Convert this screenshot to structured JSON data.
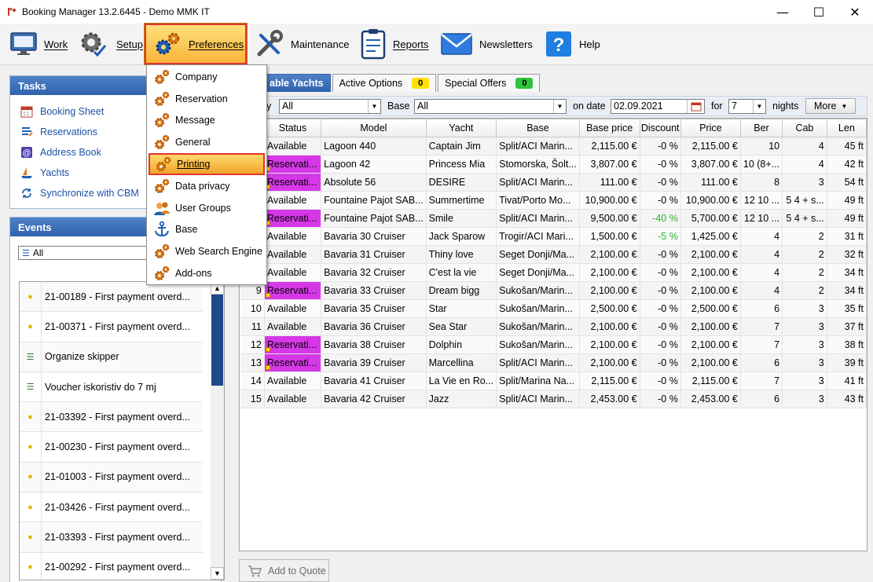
{
  "window": {
    "title": "Booking Manager 13.2.6445 - Demo MMK IT",
    "controls": [
      "minimize",
      "maximize",
      "close"
    ]
  },
  "toolbar": {
    "work": "Work",
    "setup": "Setup",
    "preferences": "Preferences",
    "maintenance": "Maintenance",
    "reports": "Reports",
    "newsletters": "Newsletters",
    "help": "Help"
  },
  "preferences_menu": {
    "items": [
      "Company",
      "Reservation",
      "Message",
      "General",
      "Printing",
      "Data privacy",
      "User Groups",
      "Base",
      "Web Search Engine",
      "Add-ons"
    ],
    "highlighted": "Printing"
  },
  "tasks": {
    "title": "Tasks",
    "items": [
      "Booking Sheet",
      "Reservations",
      "Address Book",
      "Yachts",
      "Synchronize with CBM"
    ]
  },
  "events": {
    "title": "Events",
    "filter": "All",
    "items": [
      "21-00189 - First payment overd...",
      "21-00371 - First payment overd...",
      "Organize skipper",
      "Voucher iskoristiv do 7 mj",
      "21-03392 - First payment overd...",
      "21-00230 - First payment overd...",
      "21-01003 - First payment overd...",
      "21-03426 - First payment overd...",
      "21-03393 - First payment overd...",
      "21-00292 - First payment overd..."
    ]
  },
  "tabs": [
    {
      "label": "able Yachts",
      "badge": null
    },
    {
      "label": "Active Options",
      "badge": "0"
    },
    {
      "label": "Special Offers",
      "badge": "0"
    }
  ],
  "filters": {
    "category_label": "y",
    "category_value": "All",
    "base_label": "Base",
    "base_value": "All",
    "date_label": "on date",
    "date_value": "02.09.2021",
    "for_label": "for",
    "nights_value": "7",
    "nights_label": "nights",
    "more_button": "More"
  },
  "grid": {
    "columns": [
      "",
      "Status",
      "Model",
      "Yacht",
      "Base",
      "Base price",
      "Discount",
      "Price",
      "Ber",
      "Cab",
      "Len"
    ],
    "rows": [
      [
        "",
        "Available",
        "Lagoon 440",
        "Captain Jim",
        "Split/ACI Marin...",
        "2,115.00 €",
        "-0 %",
        "2,115.00 €",
        "10",
        "4",
        "45 ft"
      ],
      [
        "",
        "Reservati...",
        "Lagoon 42",
        "Princess Mia",
        "Stomorska, Šolt...",
        "3,807.00 €",
        "-0 %",
        "3,807.00 €",
        "10 (8+...",
        "4",
        "42 ft"
      ],
      [
        "",
        "Reservati...",
        "Absolute 56",
        "DESIRE",
        "Split/ACI Marin...",
        "111.00 €",
        "-0 %",
        "111.00 €",
        "8",
        "3",
        "54 ft"
      ],
      [
        "",
        "Available",
        "Fountaine Pajot SAB...",
        "Summertime",
        "Tivat/Porto Mo...",
        "10,900.00 €",
        "-0 %",
        "10,900.00 €",
        "12 10 ...",
        "5 4 + s...",
        "49 ft"
      ],
      [
        "",
        "Reservati...",
        "Fountaine Pajot SAB...",
        "Smile",
        "Split/ACI Marin...",
        "9,500.00 €",
        "-40 %",
        "5,700.00 €",
        "12 10 ...",
        "5 4 + s...",
        "49 ft"
      ],
      [
        "",
        "Available",
        "Bavaria 30 Cruiser",
        "Jack Sparow",
        "Trogir/ACI Mari...",
        "1,500.00 €",
        "-5 %",
        "1,425.00 €",
        "4",
        "2",
        "31 ft"
      ],
      [
        "",
        "Available",
        "Bavaria 31 Cruiser",
        "Thiny love",
        "Seget Donji/Ma...",
        "2,100.00 €",
        "-0 %",
        "2,100.00 €",
        "4",
        "2",
        "32 ft"
      ],
      [
        "",
        "Available",
        "Bavaria 32 Cruiser",
        "C'est la vie",
        "Seget Donji/Ma...",
        "2,100.00 €",
        "-0 %",
        "2,100.00 €",
        "4",
        "2",
        "34 ft"
      ],
      [
        "9",
        "Reservati...",
        "Bavaria 33 Cruiser",
        "Dream bigg",
        "Sukošan/Marin...",
        "2,100.00 €",
        "-0 %",
        "2,100.00 €",
        "4",
        "2",
        "34 ft"
      ],
      [
        "10",
        "Available",
        "Bavaria 35 Cruiser",
        "Star",
        "Sukošan/Marin...",
        "2,500.00 €",
        "-0 %",
        "2,500.00 €",
        "6",
        "3",
        "35 ft"
      ],
      [
        "11",
        "Available",
        "Bavaria 36 Cruiser",
        "Sea Star",
        "Sukošan/Marin...",
        "2,100.00 €",
        "-0 %",
        "2,100.00 €",
        "7",
        "3",
        "37 ft"
      ],
      [
        "12",
        "Reservati...",
        "Bavaria 38 Cruiser",
        "Dolphin",
        "Sukošan/Marin...",
        "2,100.00 €",
        "-0 %",
        "2,100.00 €",
        "7",
        "3",
        "38 ft"
      ],
      [
        "13",
        "Reservati...",
        "Bavaria 39 Cruiser",
        "Marcellina",
        "Split/ACI Marin...",
        "2,100.00 €",
        "-0 %",
        "2,100.00 €",
        "6",
        "3",
        "39 ft"
      ],
      [
        "14",
        "Available",
        "Bavaria 41 Cruiser",
        "La Vie en Ro...",
        "Split/Marina Na...",
        "2,115.00 €",
        "-0 %",
        "2,115.00 €",
        "7",
        "3",
        "41 ft"
      ],
      [
        "15",
        "Available",
        "Bavaria 42 Cruiser",
        "Jazz",
        "Split/ACI Marin...",
        "2,453.00 €",
        "-0 %",
        "2,453.00 €",
        "6",
        "3",
        "43 ft"
      ]
    ]
  },
  "add_to_quote": "Add to Quote",
  "colors": {
    "reservation": "#d638e8",
    "highlight": "#f3a52a",
    "panel_head": "#2e63ae",
    "discount_green": "#2bb32b"
  }
}
